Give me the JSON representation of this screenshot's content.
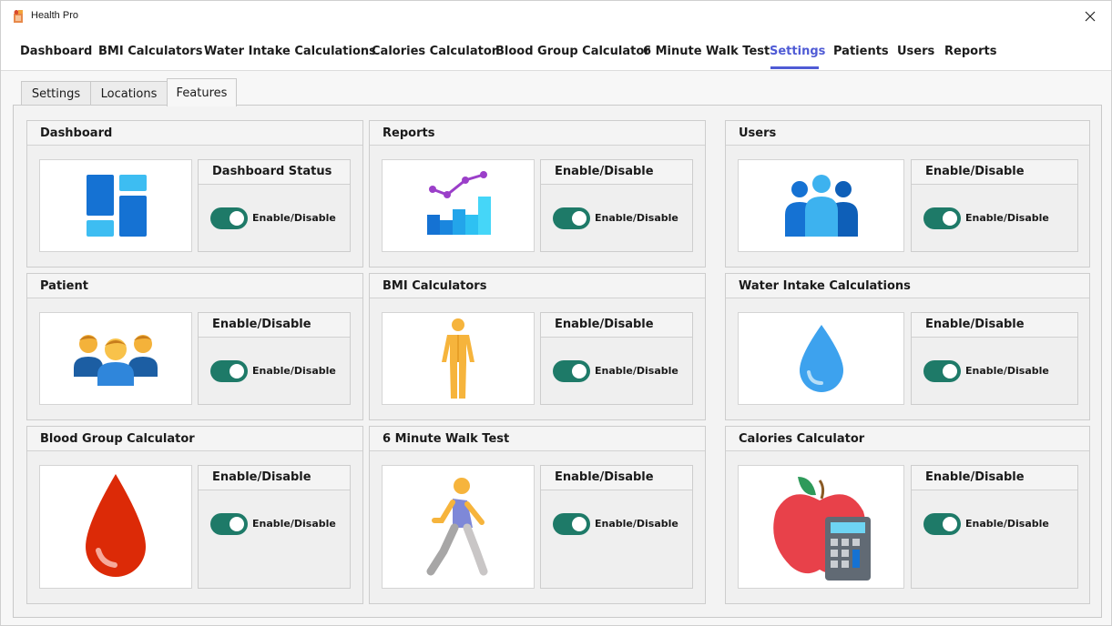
{
  "window": {
    "title": "Health Pro"
  },
  "main_nav": [
    {
      "label": "Dashboard",
      "active": false
    },
    {
      "label": "BMI Calculators",
      "active": false
    },
    {
      "label": "Water Intake Calculations",
      "active": false
    },
    {
      "label": "Calories Calculator",
      "active": false
    },
    {
      "label": "Blood Group Calculator",
      "active": false
    },
    {
      "label": "6 Minute Walk Test",
      "active": false
    },
    {
      "label": "Settings",
      "active": true
    },
    {
      "label": "Patients",
      "active": false
    },
    {
      "label": "Users",
      "active": false
    },
    {
      "label": "Reports",
      "active": false
    }
  ],
  "sub_tabs": [
    {
      "label": "Settings",
      "active": false
    },
    {
      "label": "Locations",
      "active": false
    },
    {
      "label": "Features",
      "active": true
    }
  ],
  "cards": [
    {
      "title": "Dashboard",
      "icon": "dashboard-tiles-icon",
      "panel_title": "Dashboard Status",
      "toggle_label": "Enable/Disable",
      "enabled": true
    },
    {
      "title": "Reports",
      "icon": "report-chart-icon",
      "panel_title": "Enable/Disable",
      "toggle_label": "Enable/Disable",
      "enabled": true
    },
    {
      "title": "Users",
      "icon": "users-group-icon",
      "panel_title": "Enable/Disable",
      "toggle_label": "Enable/Disable",
      "enabled": true
    },
    {
      "title": "Patient",
      "icon": "patients-group-icon",
      "panel_title": "Enable/Disable",
      "toggle_label": "Enable/Disable",
      "enabled": true
    },
    {
      "title": "BMI Calculators",
      "icon": "human-body-icon",
      "panel_title": "Enable/Disable",
      "toggle_label": "Enable/Disable",
      "enabled": true
    },
    {
      "title": "Water Intake Calculations",
      "icon": "water-drop-icon",
      "panel_title": "Enable/Disable",
      "toggle_label": "Enable/Disable",
      "enabled": true
    },
    {
      "title": "Blood Group Calculator",
      "icon": "blood-drop-icon",
      "panel_title": "Enable/Disable",
      "toggle_label": "Enable/Disable",
      "enabled": true
    },
    {
      "title": "6 Minute Walk Test",
      "icon": "walking-person-icon",
      "panel_title": "Enable/Disable",
      "toggle_label": "Enable/Disable",
      "enabled": true
    },
    {
      "title": "Calories Calculator",
      "icon": "apple-calculator-icon",
      "panel_title": "Enable/Disable",
      "toggle_label": "Enable/Disable",
      "enabled": true
    }
  ],
  "colors": {
    "accent": "#4f5bd5",
    "toggle_on": "#1e7a68"
  }
}
